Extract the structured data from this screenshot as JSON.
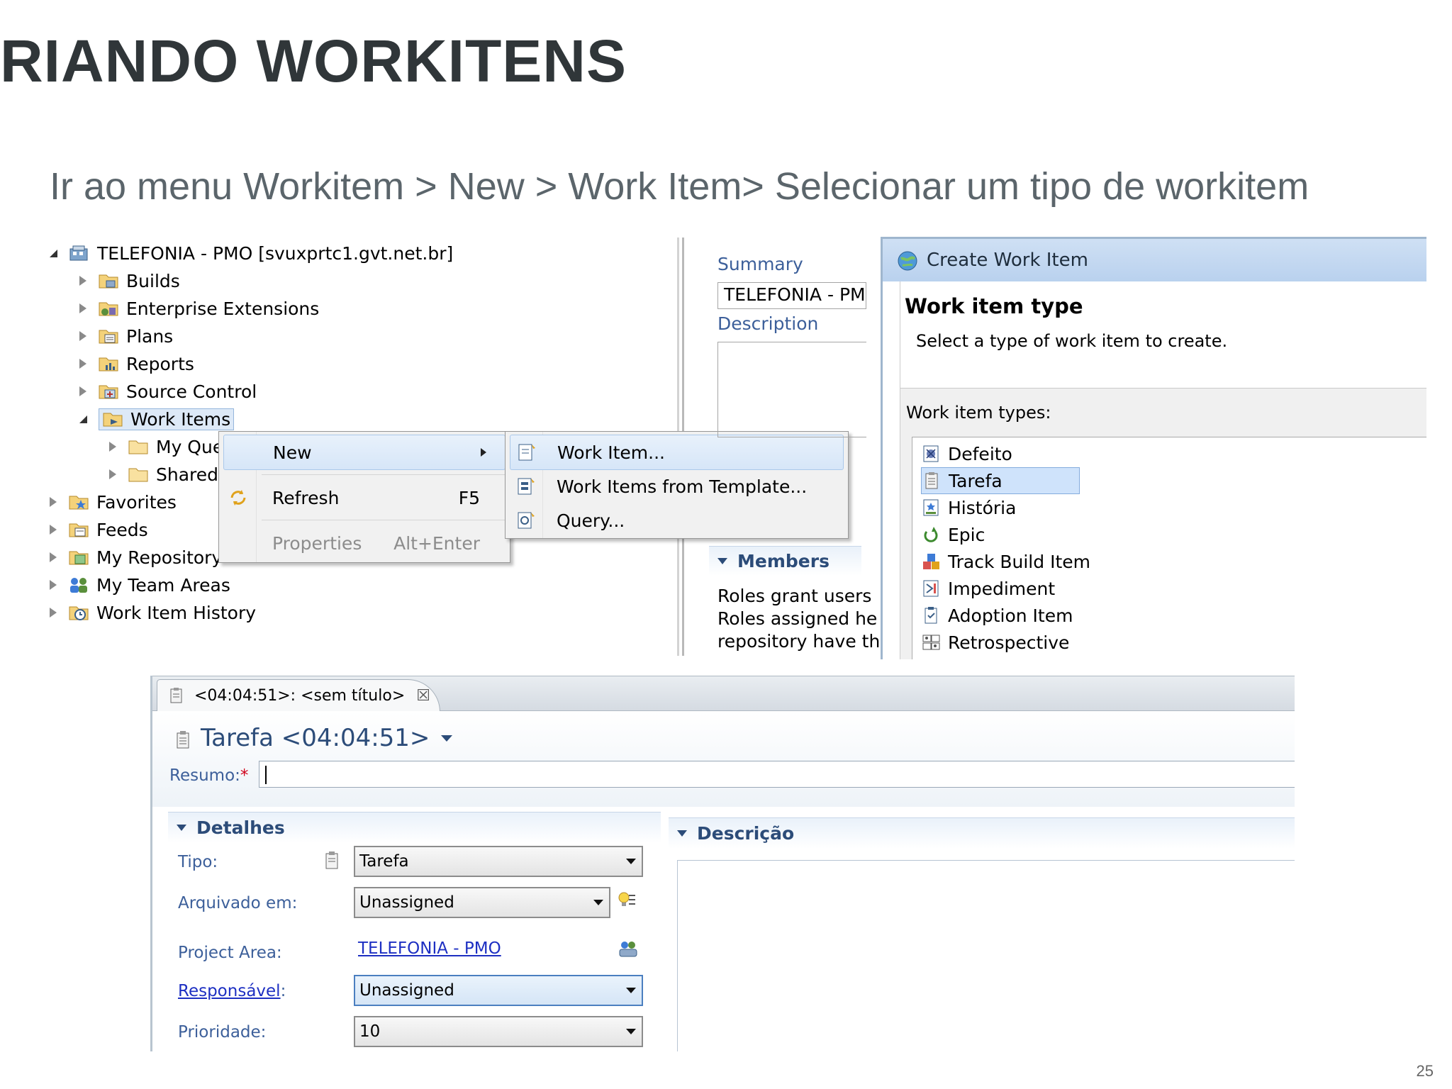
{
  "slide": {
    "title": "RIANDO WORKITENS",
    "subtitle": "Ir ao menu Workitem > New > Work Item> Selecionar um tipo de workitem",
    "page_number": "25"
  },
  "tree": {
    "root": "TELEFONIA - PMO [svuxprtc1.gvt.net.br]",
    "items": {
      "builds": "Builds",
      "enterprise_extensions": "Enterprise Extensions",
      "plans": "Plans",
      "reports": "Reports",
      "source_control": "Source Control",
      "work_items": "Work Items",
      "my_queries": "My Que",
      "shared": "Shared",
      "favorites": "Favorites",
      "feeds": "Feeds",
      "my_repository": "My Repository",
      "my_team_areas": "My Team Areas",
      "work_item_history": "Work Item History"
    }
  },
  "context_menu": {
    "new": "New",
    "refresh": "Refresh",
    "refresh_shortcut": "F5",
    "properties": "Properties",
    "properties_shortcut": "Alt+Enter"
  },
  "submenu": {
    "work_item": "Work Item...",
    "from_template": "Work Items from Template...",
    "query": "Query..."
  },
  "editor_fragment": {
    "summary_label": "Summary",
    "summary_value": "TELEFONIA - PM",
    "description_label": "Description",
    "members_label": "Members",
    "members_text_1": "Roles grant users",
    "members_text_2": "Roles assigned he",
    "members_text_3": "repository have th"
  },
  "create_dialog": {
    "title": "Create Work Item",
    "heading": "Work item type",
    "instruction": "Select a type of work item to create.",
    "types_label": "Work item types:",
    "types": [
      "Defeito",
      "Tarefa",
      "História",
      "Epic",
      "Track Build Item",
      "Impediment",
      "Adoption Item",
      "Retrospective"
    ],
    "selected_type": "Tarefa"
  },
  "wi_editor": {
    "tab_title": "<04:04:51>: <sem título>",
    "title": "Tarefa <04:04:51>",
    "resumo_label": "Resumo:",
    "required_mark": "*",
    "resumo_value": "",
    "detalhes_label": "Detalhes",
    "descricao_label": "Descrição",
    "fields": {
      "tipo_label": "Tipo:",
      "tipo_value": "Tarefa",
      "arquivado_label": "Arquivado em:",
      "arquivado_value": "Unassigned",
      "project_area_label": "Project Area:",
      "project_area_value": "TELEFONIA - PMO",
      "responsavel_label": "Responsável",
      "responsavel_suffix": ":",
      "responsavel_value": "Unassigned",
      "prioridade_label": "Prioridade:",
      "prioridade_value": "10"
    }
  },
  "colors": {
    "title_gray": "#303639",
    "subtitle_gray": "#5b656b",
    "label_blue": "#3c5f9a",
    "link_blue": "#1d2fc2",
    "selection_blue": "#cfe3fb"
  }
}
